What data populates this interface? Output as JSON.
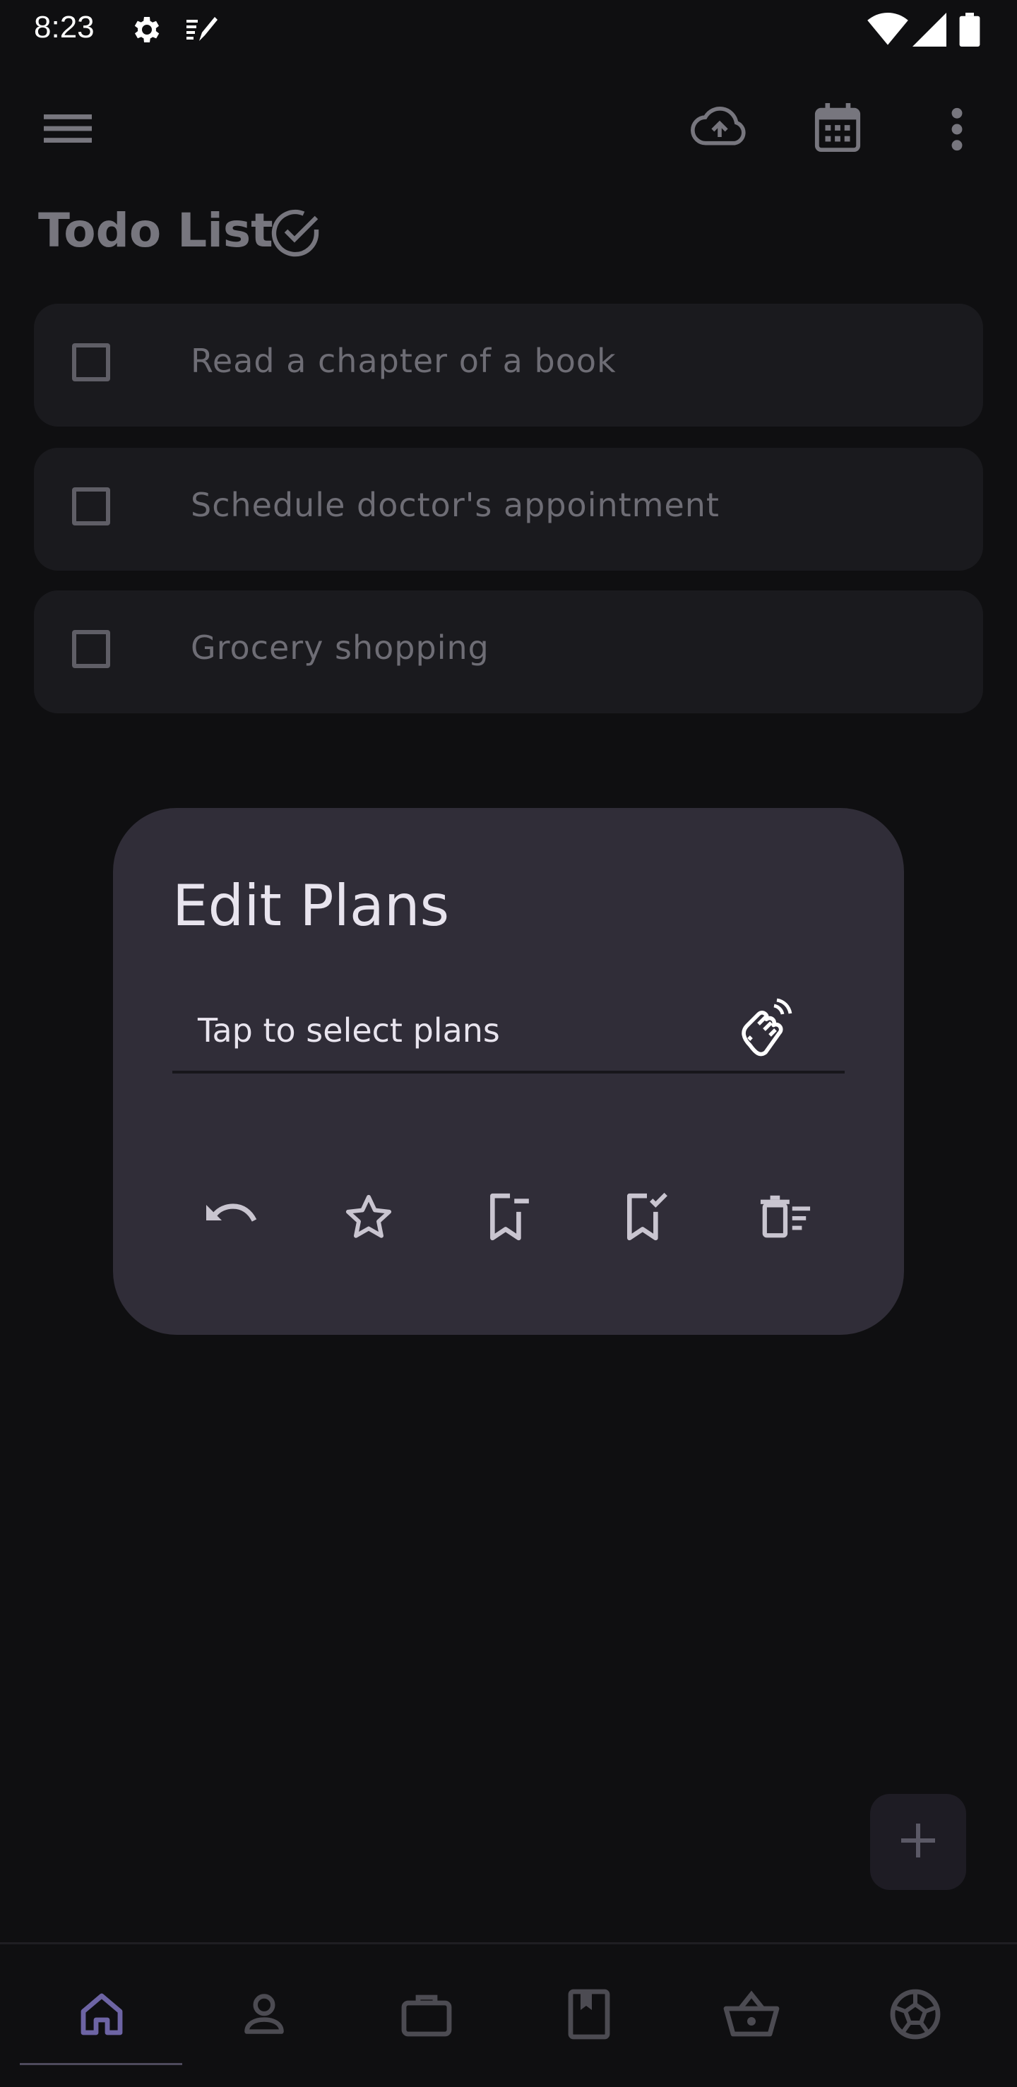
{
  "status_bar": {
    "time": "8:23",
    "icons": [
      "gear-icon",
      "notes-icon",
      "wifi-icon",
      "signal-icon",
      "battery-icon"
    ]
  },
  "app_bar": {
    "icons": [
      "menu-icon",
      "cloud-upload-icon",
      "calendar-icon",
      "more-vert-icon"
    ]
  },
  "page": {
    "title": "Todo List",
    "title_icon": "check-circle-icon"
  },
  "tasks": [
    {
      "text": "Read a chapter of a book",
      "checked": false
    },
    {
      "text": "Schedule doctor's appointment",
      "checked": false
    },
    {
      "text": "Grocery shopping",
      "checked": false
    }
  ],
  "dialog": {
    "title": "Edit Plans",
    "select_placeholder": "Tap to select plans",
    "select_icon": "hand-tap-icon",
    "actions": [
      "undo-icon",
      "star-icon",
      "bookmark-remove-icon",
      "bookmark-check-icon",
      "delete-sweep-icon"
    ]
  },
  "fab": {
    "icon": "plus-icon"
  },
  "bottom_nav": {
    "items": [
      "home-icon",
      "person-icon",
      "briefcase-icon",
      "book-icon",
      "basket-icon",
      "soccer-ball-icon"
    ],
    "selected": "home-icon"
  },
  "colors": {
    "background": "#0f0f11",
    "card": "#1a1a1e",
    "dialog": "#302d38",
    "accent": "#6d64a4",
    "muted_text": "#6e6d75"
  }
}
